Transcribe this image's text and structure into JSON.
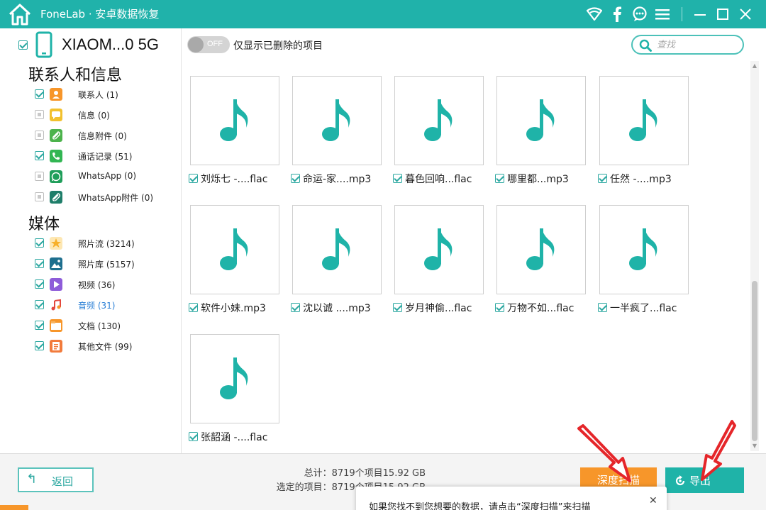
{
  "window": {
    "app_title": "FoneLab · 安卓数据恢复",
    "icons": [
      "home-icon",
      "wifi-icon",
      "facebook-icon",
      "chat-icon",
      "menu-icon",
      "minimize-icon",
      "maximize-icon",
      "close-icon"
    ]
  },
  "device": {
    "name": "XIAOM...0 5G",
    "checked": true
  },
  "sidebar": {
    "groups": [
      {
        "title": "联系人和信息",
        "items": [
          {
            "label": "联系人 (1)",
            "checked": true,
            "icon": "contacts-icon",
            "color": "#f7962a"
          },
          {
            "label": "信息 (0)",
            "checked": false,
            "icon": "message-icon",
            "color": "#f2c12e"
          },
          {
            "label": "信息附件 (0)",
            "checked": false,
            "icon": "attachment-icon",
            "color": "#4cb34c"
          },
          {
            "label": "通话记录 (51)",
            "checked": true,
            "icon": "phone-icon",
            "color": "#32b653"
          },
          {
            "label": "WhatsApp (0)",
            "checked": false,
            "icon": "whatsapp-icon",
            "color": "#1f9e5a"
          },
          {
            "label": "WhatsApp附件 (0)",
            "checked": false,
            "icon": "whatsapp-attachment-icon",
            "color": "#1f7e6a"
          }
        ]
      },
      {
        "title": "媒体",
        "items": [
          {
            "label": "照片流 (3214)",
            "checked": true,
            "icon": "photo-stream-icon",
            "color": "#f7b02a"
          },
          {
            "label": "照片库 (5157)",
            "checked": true,
            "icon": "photo-library-icon",
            "color": "#1e6f8e"
          },
          {
            "label": "视频 (36)",
            "checked": true,
            "icon": "video-icon",
            "color": "#8e5cd9"
          },
          {
            "label": "音频 (31)",
            "checked": true,
            "icon": "audio-icon",
            "color": "#e2473f",
            "active": true
          },
          {
            "label": "文档 (130)",
            "checked": true,
            "icon": "document-icon",
            "color": "#f7962a"
          },
          {
            "label": "其他文件 (99)",
            "checked": true,
            "icon": "other-files-icon",
            "color": "#f27b3c"
          }
        ]
      }
    ]
  },
  "toolbar": {
    "toggle_text": "OFF",
    "filter_label": "仅显示已删除的项目",
    "search_placeholder": "查找"
  },
  "files": [
    "刘烁七 -....flac",
    "命运-家....mp3",
    "暮色回响...flac",
    "哪里都...mp3",
    "任然 -....mp3",
    "软件小妹.mp3",
    "沈以诚 ....mp3",
    "岁月神偷...flac",
    "万物不如...flac",
    "一半疯了...flac",
    "张韶涵 -....flac"
  ],
  "bottom": {
    "back_label": "返回",
    "total": "总计：8719个项目15.92 GB",
    "selected": "选定的项目：8719个项目15.92 GB",
    "deep_scan_label": "深度扫描",
    "export_label": "导出"
  },
  "tooltip": {
    "text": "如果您找不到您想要的数据，请点击“深度扫描”来扫描",
    "close": "✕"
  },
  "colors": {
    "brand": "#20b2aa",
    "note": "#1fb3a8",
    "deep_scan": "#f7962a",
    "export": "#1fb3a8",
    "annotation_arrow": "#e5262a"
  }
}
